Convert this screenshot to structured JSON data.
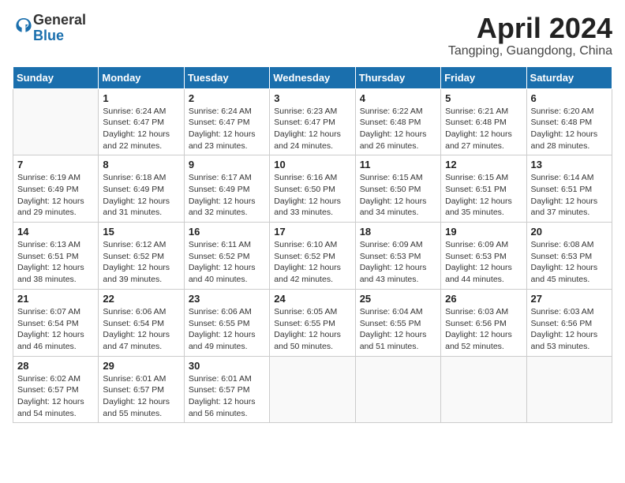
{
  "logo": {
    "general": "General",
    "blue": "Blue"
  },
  "title": "April 2024",
  "location": "Tangping, Guangdong, China",
  "weekdays": [
    "Sunday",
    "Monday",
    "Tuesday",
    "Wednesday",
    "Thursday",
    "Friday",
    "Saturday"
  ],
  "weeks": [
    [
      {
        "day": "",
        "info": ""
      },
      {
        "day": "1",
        "info": "Sunrise: 6:24 AM\nSunset: 6:47 PM\nDaylight: 12 hours\nand 22 minutes."
      },
      {
        "day": "2",
        "info": "Sunrise: 6:24 AM\nSunset: 6:47 PM\nDaylight: 12 hours\nand 23 minutes."
      },
      {
        "day": "3",
        "info": "Sunrise: 6:23 AM\nSunset: 6:47 PM\nDaylight: 12 hours\nand 24 minutes."
      },
      {
        "day": "4",
        "info": "Sunrise: 6:22 AM\nSunset: 6:48 PM\nDaylight: 12 hours\nand 26 minutes."
      },
      {
        "day": "5",
        "info": "Sunrise: 6:21 AM\nSunset: 6:48 PM\nDaylight: 12 hours\nand 27 minutes."
      },
      {
        "day": "6",
        "info": "Sunrise: 6:20 AM\nSunset: 6:48 PM\nDaylight: 12 hours\nand 28 minutes."
      }
    ],
    [
      {
        "day": "7",
        "info": "Sunrise: 6:19 AM\nSunset: 6:49 PM\nDaylight: 12 hours\nand 29 minutes."
      },
      {
        "day": "8",
        "info": "Sunrise: 6:18 AM\nSunset: 6:49 PM\nDaylight: 12 hours\nand 31 minutes."
      },
      {
        "day": "9",
        "info": "Sunrise: 6:17 AM\nSunset: 6:49 PM\nDaylight: 12 hours\nand 32 minutes."
      },
      {
        "day": "10",
        "info": "Sunrise: 6:16 AM\nSunset: 6:50 PM\nDaylight: 12 hours\nand 33 minutes."
      },
      {
        "day": "11",
        "info": "Sunrise: 6:15 AM\nSunset: 6:50 PM\nDaylight: 12 hours\nand 34 minutes."
      },
      {
        "day": "12",
        "info": "Sunrise: 6:15 AM\nSunset: 6:51 PM\nDaylight: 12 hours\nand 35 minutes."
      },
      {
        "day": "13",
        "info": "Sunrise: 6:14 AM\nSunset: 6:51 PM\nDaylight: 12 hours\nand 37 minutes."
      }
    ],
    [
      {
        "day": "14",
        "info": "Sunrise: 6:13 AM\nSunset: 6:51 PM\nDaylight: 12 hours\nand 38 minutes."
      },
      {
        "day": "15",
        "info": "Sunrise: 6:12 AM\nSunset: 6:52 PM\nDaylight: 12 hours\nand 39 minutes."
      },
      {
        "day": "16",
        "info": "Sunrise: 6:11 AM\nSunset: 6:52 PM\nDaylight: 12 hours\nand 40 minutes."
      },
      {
        "day": "17",
        "info": "Sunrise: 6:10 AM\nSunset: 6:52 PM\nDaylight: 12 hours\nand 42 minutes."
      },
      {
        "day": "18",
        "info": "Sunrise: 6:09 AM\nSunset: 6:53 PM\nDaylight: 12 hours\nand 43 minutes."
      },
      {
        "day": "19",
        "info": "Sunrise: 6:09 AM\nSunset: 6:53 PM\nDaylight: 12 hours\nand 44 minutes."
      },
      {
        "day": "20",
        "info": "Sunrise: 6:08 AM\nSunset: 6:53 PM\nDaylight: 12 hours\nand 45 minutes."
      }
    ],
    [
      {
        "day": "21",
        "info": "Sunrise: 6:07 AM\nSunset: 6:54 PM\nDaylight: 12 hours\nand 46 minutes."
      },
      {
        "day": "22",
        "info": "Sunrise: 6:06 AM\nSunset: 6:54 PM\nDaylight: 12 hours\nand 47 minutes."
      },
      {
        "day": "23",
        "info": "Sunrise: 6:06 AM\nSunset: 6:55 PM\nDaylight: 12 hours\nand 49 minutes."
      },
      {
        "day": "24",
        "info": "Sunrise: 6:05 AM\nSunset: 6:55 PM\nDaylight: 12 hours\nand 50 minutes."
      },
      {
        "day": "25",
        "info": "Sunrise: 6:04 AM\nSunset: 6:55 PM\nDaylight: 12 hours\nand 51 minutes."
      },
      {
        "day": "26",
        "info": "Sunrise: 6:03 AM\nSunset: 6:56 PM\nDaylight: 12 hours\nand 52 minutes."
      },
      {
        "day": "27",
        "info": "Sunrise: 6:03 AM\nSunset: 6:56 PM\nDaylight: 12 hours\nand 53 minutes."
      }
    ],
    [
      {
        "day": "28",
        "info": "Sunrise: 6:02 AM\nSunset: 6:57 PM\nDaylight: 12 hours\nand 54 minutes."
      },
      {
        "day": "29",
        "info": "Sunrise: 6:01 AM\nSunset: 6:57 PM\nDaylight: 12 hours\nand 55 minutes."
      },
      {
        "day": "30",
        "info": "Sunrise: 6:01 AM\nSunset: 6:57 PM\nDaylight: 12 hours\nand 56 minutes."
      },
      {
        "day": "",
        "info": ""
      },
      {
        "day": "",
        "info": ""
      },
      {
        "day": "",
        "info": ""
      },
      {
        "day": "",
        "info": ""
      }
    ]
  ]
}
